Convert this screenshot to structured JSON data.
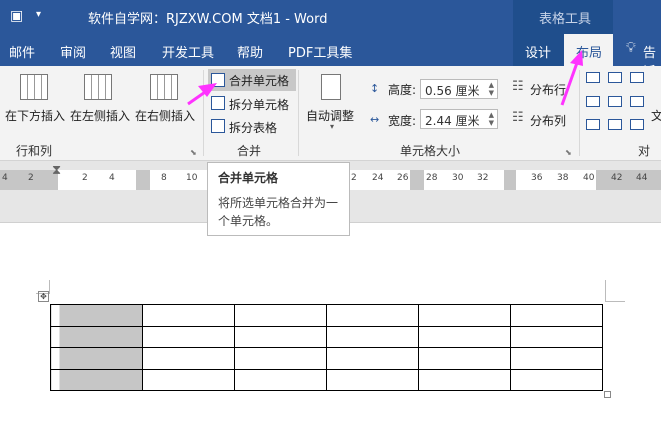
{
  "title_bar": {
    "doc_title": "软件自学网：RJZXW.COM  文档1  -  Word",
    "context_label": "表格工具"
  },
  "tabs": [
    "邮件",
    "审阅",
    "视图",
    "开发工具",
    "帮助",
    "PDF工具集",
    "设计",
    "布局",
    "告诉"
  ],
  "active_tab": "布局",
  "ribbon": {
    "rows_cols": {
      "buttons": [
        "在下方插入",
        "在左侧插入",
        "在右侧插入"
      ],
      "label": "行和列"
    },
    "merge": {
      "buttons": [
        "合并单元格",
        "拆分单元格",
        "拆分表格"
      ],
      "label": "合并"
    },
    "cell_size": {
      "autofit": "自动调整",
      "height_label": "高度:",
      "height_value": "0.56 厘米",
      "width_label": "宽度:",
      "width_value": "2.44 厘米",
      "dist_rows": "分布行",
      "dist_cols": "分布列",
      "label": "单元格大小"
    },
    "align": {
      "label": "对齐",
      "text_dir": "文"
    }
  },
  "ruler": {
    "ticks": [
      "4",
      "2",
      "2",
      "4",
      "8",
      "10",
      "2",
      "24",
      "26",
      "28",
      "30",
      "32",
      "36",
      "38",
      "40",
      "42",
      "44"
    ]
  },
  "tooltip": {
    "title": "合并单元格",
    "body": "将所选单元格合并为一个单元格。"
  },
  "table": {
    "rows": 4,
    "cols": 6
  },
  "colors": {
    "accent": "#2b579a",
    "arrow": "#ff33ff"
  }
}
